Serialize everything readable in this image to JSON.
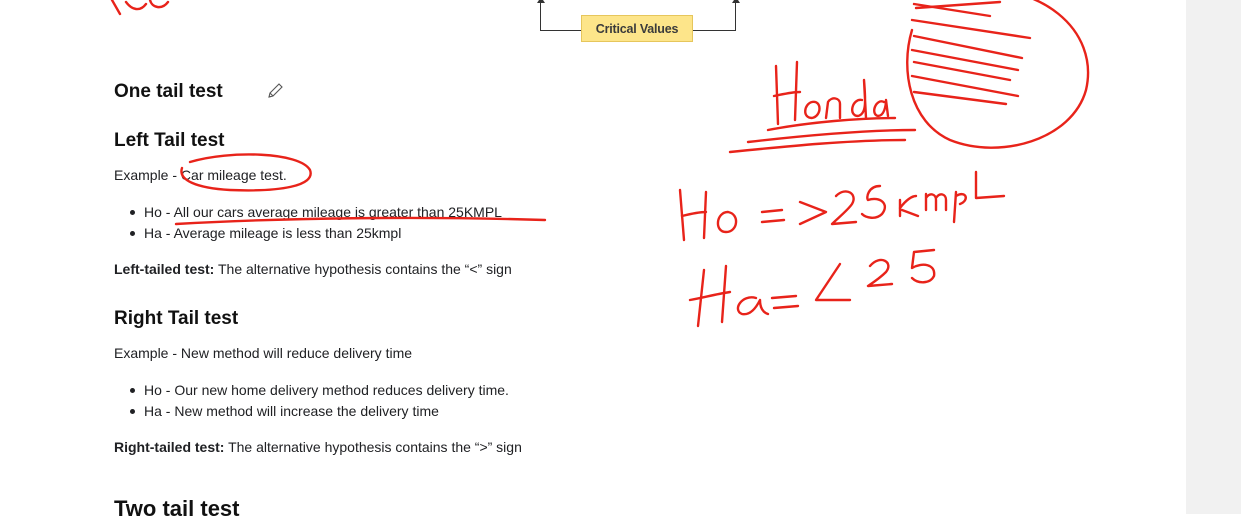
{
  "figure": {
    "critical_label": "Critical Values"
  },
  "sections": {
    "one_tail": {
      "heading": "One tail test"
    },
    "left_tail": {
      "heading": "Left Tail test",
      "example_prefix": "Example - ",
      "example_text": "Car mileage test.",
      "ho_prefix": "Ho - ",
      "ho_text": "All our cars average mileage is greater than 25KMPL",
      "ha_prefix": "Ha - ",
      "ha_text": "Average mileage is less than 25kmpl",
      "summary_bold": "Left-tailed test:",
      "summary_text": " The alternative hypothesis contains the “<” sign"
    },
    "right_tail": {
      "heading": "Right Tail test",
      "example_prefix": "Example - ",
      "example_text": "New method will reduce delivery time",
      "ho_prefix": "Ho - ",
      "ho_text": "Our new home delivery method reduces delivery time.",
      "ha_prefix": "Ha - ",
      "ha_text": "New method will increase the delivery time",
      "summary_bold": "Right-tailed test:",
      "summary_text": " The alternative hypothesis contains the “>” sign"
    },
    "two_tail": {
      "heading": "Two tail test"
    }
  },
  "annotations": {
    "ink_color": "#e8231a",
    "handwritten": [
      "Honda",
      "Ho = >25 kmpl",
      "Ha = < 25"
    ]
  }
}
